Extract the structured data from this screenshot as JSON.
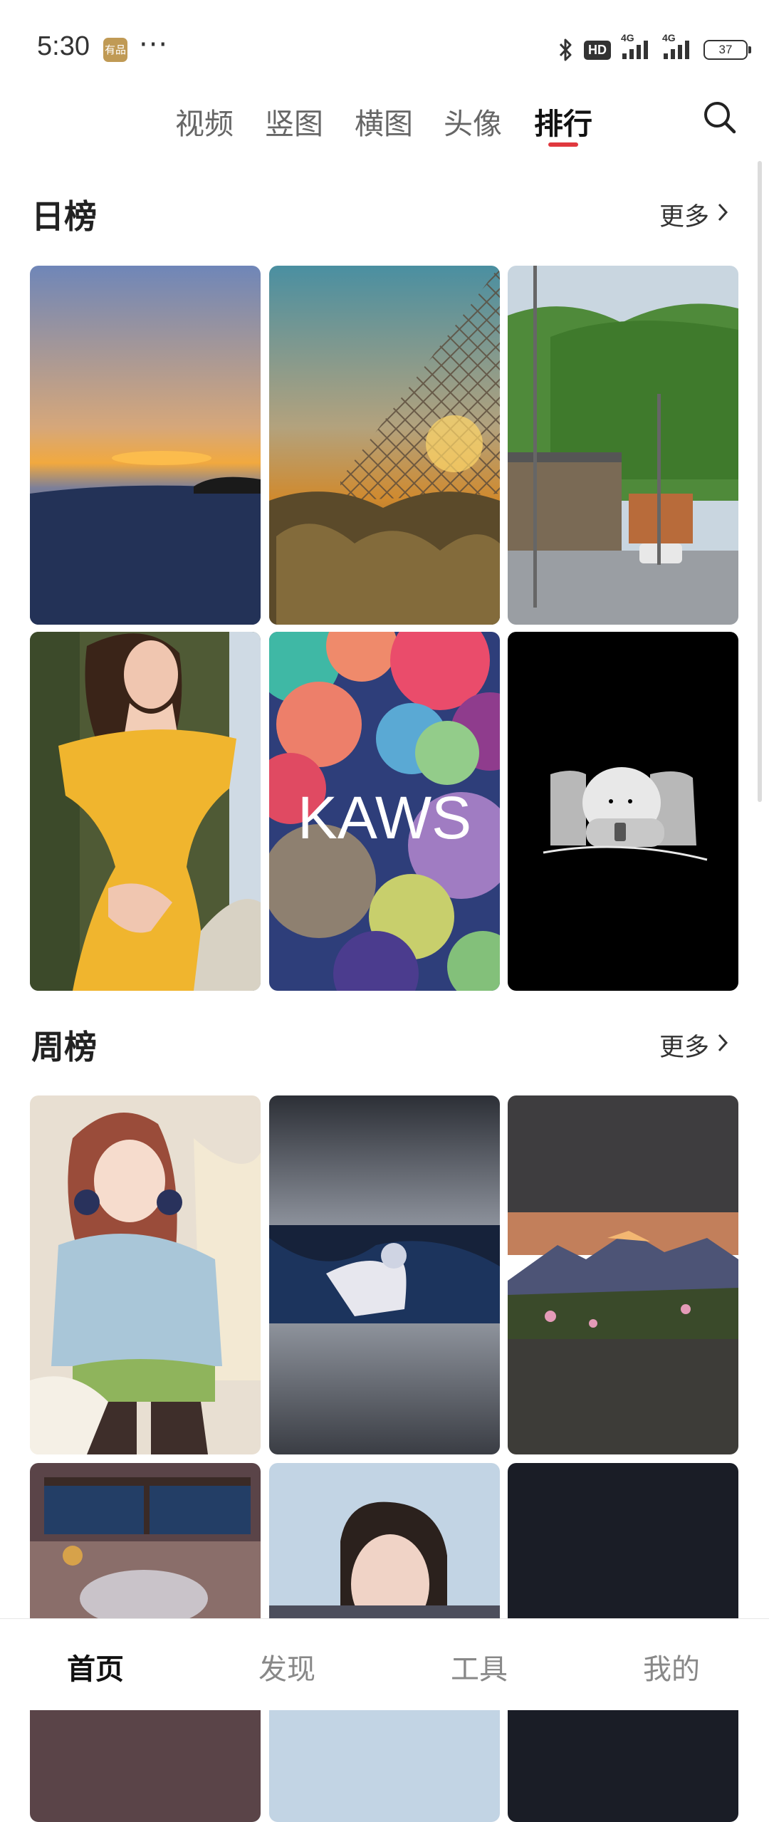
{
  "status": {
    "time": "5:30",
    "badge": "有品",
    "dots": "···",
    "hd": "HD",
    "net1": "4G",
    "net2": "4G",
    "battery": "37"
  },
  "tabs": [
    {
      "label": "视频"
    },
    {
      "label": "竖图"
    },
    {
      "label": "横图"
    },
    {
      "label": "头像"
    },
    {
      "label": "排行",
      "active": true
    }
  ],
  "daily": {
    "title": "日榜",
    "more": "更多",
    "items": [
      {
        "name": "sunset-beach"
      },
      {
        "name": "chain-fence-sunset"
      },
      {
        "name": "bamboo-street"
      },
      {
        "name": "yellow-dress-woman"
      },
      {
        "name": "kaws-pattern",
        "caption": "KAWS"
      },
      {
        "name": "cartoon-blob-night"
      }
    ]
  },
  "weekly": {
    "title": "周榜",
    "more": "更多",
    "items": [
      {
        "name": "anime-girl-headphones"
      },
      {
        "name": "anime-dark-figure"
      },
      {
        "name": "mountain-sunset"
      },
      {
        "name": "cozy-room-illustration"
      },
      {
        "name": "short-hair-portrait"
      },
      {
        "name": "dark-night"
      }
    ]
  },
  "bottom_nav": [
    {
      "label": "首页",
      "active": true
    },
    {
      "label": "发现"
    },
    {
      "label": "工具"
    },
    {
      "label": "我的"
    }
  ],
  "colors": {
    "accent": "#e0383e",
    "badge": "#c09a55"
  }
}
